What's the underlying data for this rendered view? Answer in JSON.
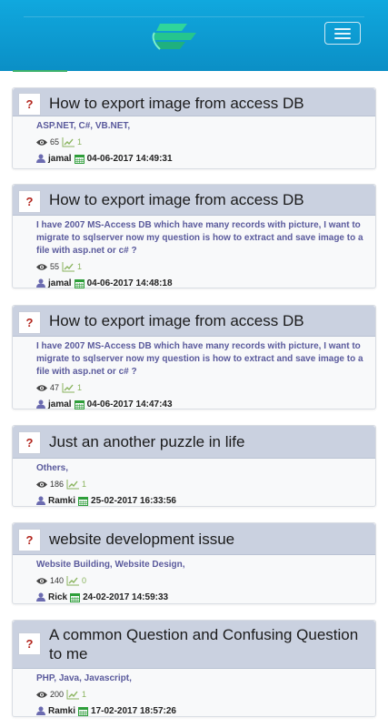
{
  "header": {
    "colors": {
      "bar": "#10a8de",
      "logo": "#2fd59b",
      "accent_line": "#3db16b"
    }
  },
  "questions": [
    {
      "title": "How to export image from access DB",
      "tags": "ASP.NET, C#, VB.NET,",
      "views": "65",
      "votes": "1",
      "user": "jamal",
      "date": "04-06-2017 14:49:31"
    },
    {
      "title": "How to export image from access DB",
      "tags": "I have 2007 MS-Access DB which have many records with picture, I want to migrate to sqlserver now my question is how to extract and save image to a file with asp.net or c# ?",
      "views": "55",
      "votes": "1",
      "user": "jamal",
      "date": "04-06-2017 14:48:18"
    },
    {
      "title": "How to export image from access DB",
      "tags": "I have 2007 MS-Access DB which have many records with picture, I want to migrate to sqlserver now my question is how to extract and save image to a file with asp.net or c# ?",
      "views": "47",
      "votes": "1",
      "user": "jamal",
      "date": "04-06-2017 14:47:43"
    },
    {
      "title": "Just an another puzzle in life",
      "tags": "Others,",
      "views": "186",
      "votes": "1",
      "user": "Ramki",
      "date": "25-02-2017 16:33:56"
    },
    {
      "title": "website development issue",
      "tags": "Website Building, Website Design,",
      "views": "140",
      "votes": "0",
      "user": "Rick",
      "date": "24-02-2017 14:59:33"
    },
    {
      "title": "A common Question and Confusing Question to me",
      "tags": "PHP, Java, Javascript,",
      "views": "200",
      "votes": "1",
      "user": "Ramki",
      "date": "17-02-2017 18:57:26"
    }
  ],
  "icons": {
    "question": "?",
    "views": "eye-icon",
    "votes": "trend-up-icon",
    "user": "user-icon",
    "date": "calendar-icon",
    "menu": "hamburger-icon"
  }
}
